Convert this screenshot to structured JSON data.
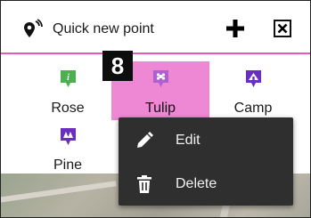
{
  "toolbar": {
    "quick_new_point_label": "Quick new point"
  },
  "tiles": [
    {
      "label": "Rose"
    },
    {
      "label": "Tulip"
    },
    {
      "label": "Camp"
    },
    {
      "label": "Pine"
    }
  ],
  "callout": "8",
  "context_menu": {
    "items": [
      {
        "label": "Edit"
      },
      {
        "label": "Delete"
      }
    ]
  },
  "colors": {
    "accent_pink": "#ee88d4",
    "menu_bg": "#2f2f2f",
    "rose_green": "#4caf50",
    "tulip_purple": "#b05fd0",
    "camp_purple": "#6b2fbf",
    "pine_purple": "#6b2fbf"
  }
}
